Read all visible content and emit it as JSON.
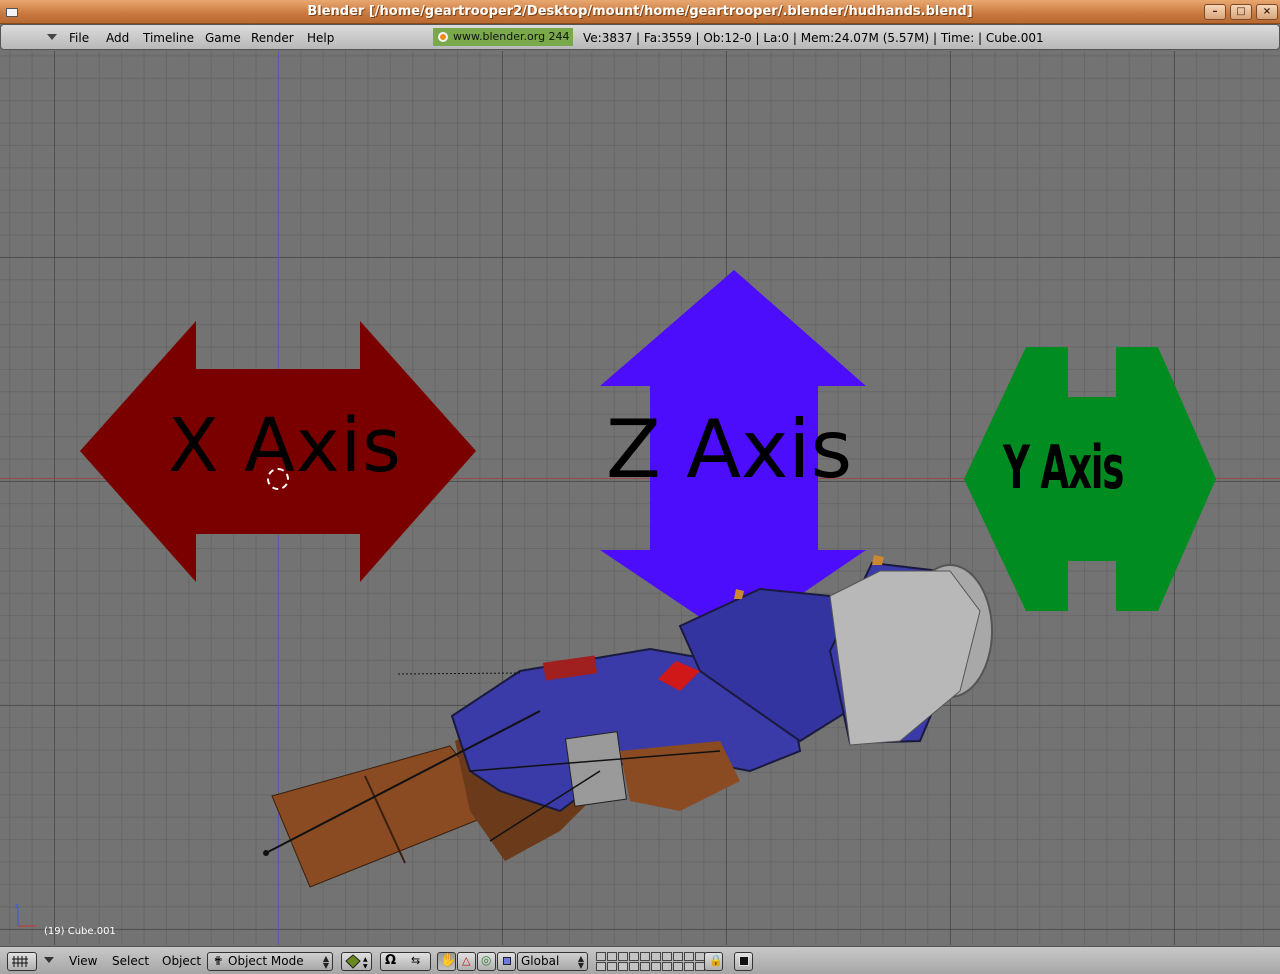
{
  "window": {
    "title": "Blender [/home/geartrooper2/Desktop/mount/home/geartrooper/.blender/hudhands.blend]",
    "buttons": {
      "minimize": "–",
      "maximize": "□",
      "close": "×"
    }
  },
  "infobar": {
    "menus": [
      "File",
      "Add",
      "Timeline",
      "Game",
      "Render",
      "Help"
    ],
    "site": "www.blender.org 244",
    "stats": "Ve:3837 | Fa:3559 | Ob:12-0 | La:0  | Mem:24.07M (5.57M)  | Time: | Cube.001"
  },
  "viewport": {
    "labels": {
      "x_axis": "X Axis",
      "z_axis": "Z Axis",
      "y_axis": "Y Axis"
    },
    "object_info": "(19) Cube.001",
    "colors": {
      "x_arrow": "#7a0000",
      "z_arrow": "#4b0dfb",
      "y_arrow": "#008c20",
      "model_blue": "#3a3aa8",
      "model_brown": "#8a4a22"
    }
  },
  "bottombar": {
    "menus": {
      "view": "View",
      "select": "Select",
      "object": "Object"
    },
    "mode": "Object Mode",
    "orientation": "Global",
    "icons": [
      "grid-icon",
      "chevron-down-icon",
      "object-mode-icon",
      "shading-icon",
      "pivot-icon",
      "snap-icon",
      "hand-icon",
      "rotate-manipulator-icon",
      "scale-manipulator-icon",
      "lock-icon",
      "render-icon"
    ]
  }
}
